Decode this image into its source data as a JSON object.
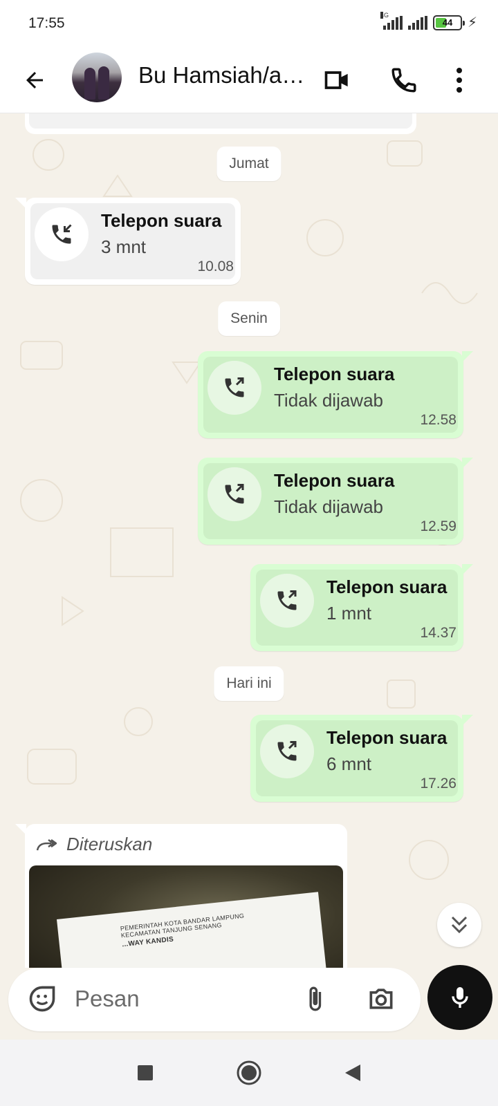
{
  "status_bar": {
    "time": "17:55",
    "network_type": "4G",
    "battery_level": "44",
    "battery_fraction": 0.44,
    "battery_color": "#58c542"
  },
  "header": {
    "contact_name": "Bu Hamsiah/a…",
    "icons": [
      "back-arrow-icon",
      "avatar",
      "video-call-icon",
      "voice-call-icon",
      "more-options-icon"
    ]
  },
  "chat": {
    "colors": {
      "incoming_bubble": "#ffffff",
      "outgoing_bubble": "#d9fdd3",
      "wallpaper": "#f5f1e9"
    },
    "date_chips": [
      "Jumat",
      "Senin",
      "Hari ini"
    ],
    "messages": [
      {
        "direction": "incoming",
        "icon": "incoming-call-icon",
        "title": "Telepon suara",
        "detail": "3 mnt",
        "time": "10.08"
      },
      {
        "direction": "outgoing",
        "icon": "outgoing-call-icon",
        "title": "Telepon suara",
        "detail": "Tidak dijawab",
        "time": "12.58"
      },
      {
        "direction": "outgoing",
        "icon": "outgoing-call-icon",
        "title": "Telepon suara",
        "detail": "Tidak dijawab",
        "time": "12.59"
      },
      {
        "direction": "outgoing",
        "icon": "outgoing-call-icon",
        "title": "Telepon suara",
        "detail": "1 mnt",
        "time": "14.37"
      },
      {
        "direction": "outgoing",
        "icon": "outgoing-call-icon",
        "title": "Telepon suara",
        "detail": "6 mnt",
        "time": "17.26"
      }
    ],
    "forwarded": {
      "label": "Diteruskan",
      "document_text_line1": "PEMERINTAH KOTA BANDAR LAMPUNG",
      "document_text_line2": "KECAMATAN TANJUNG SENANG",
      "document_text_line3": "...WAY KANDIS"
    },
    "scroll_down_icon": "double-chevron-down-icon"
  },
  "composer": {
    "placeholder": "Pesan",
    "icons": [
      "sticker-icon",
      "attach-icon",
      "camera-icon",
      "mic-icon"
    ]
  },
  "navbar": {
    "icons": [
      "recent-apps-icon",
      "home-icon",
      "back-triangle-icon"
    ]
  }
}
